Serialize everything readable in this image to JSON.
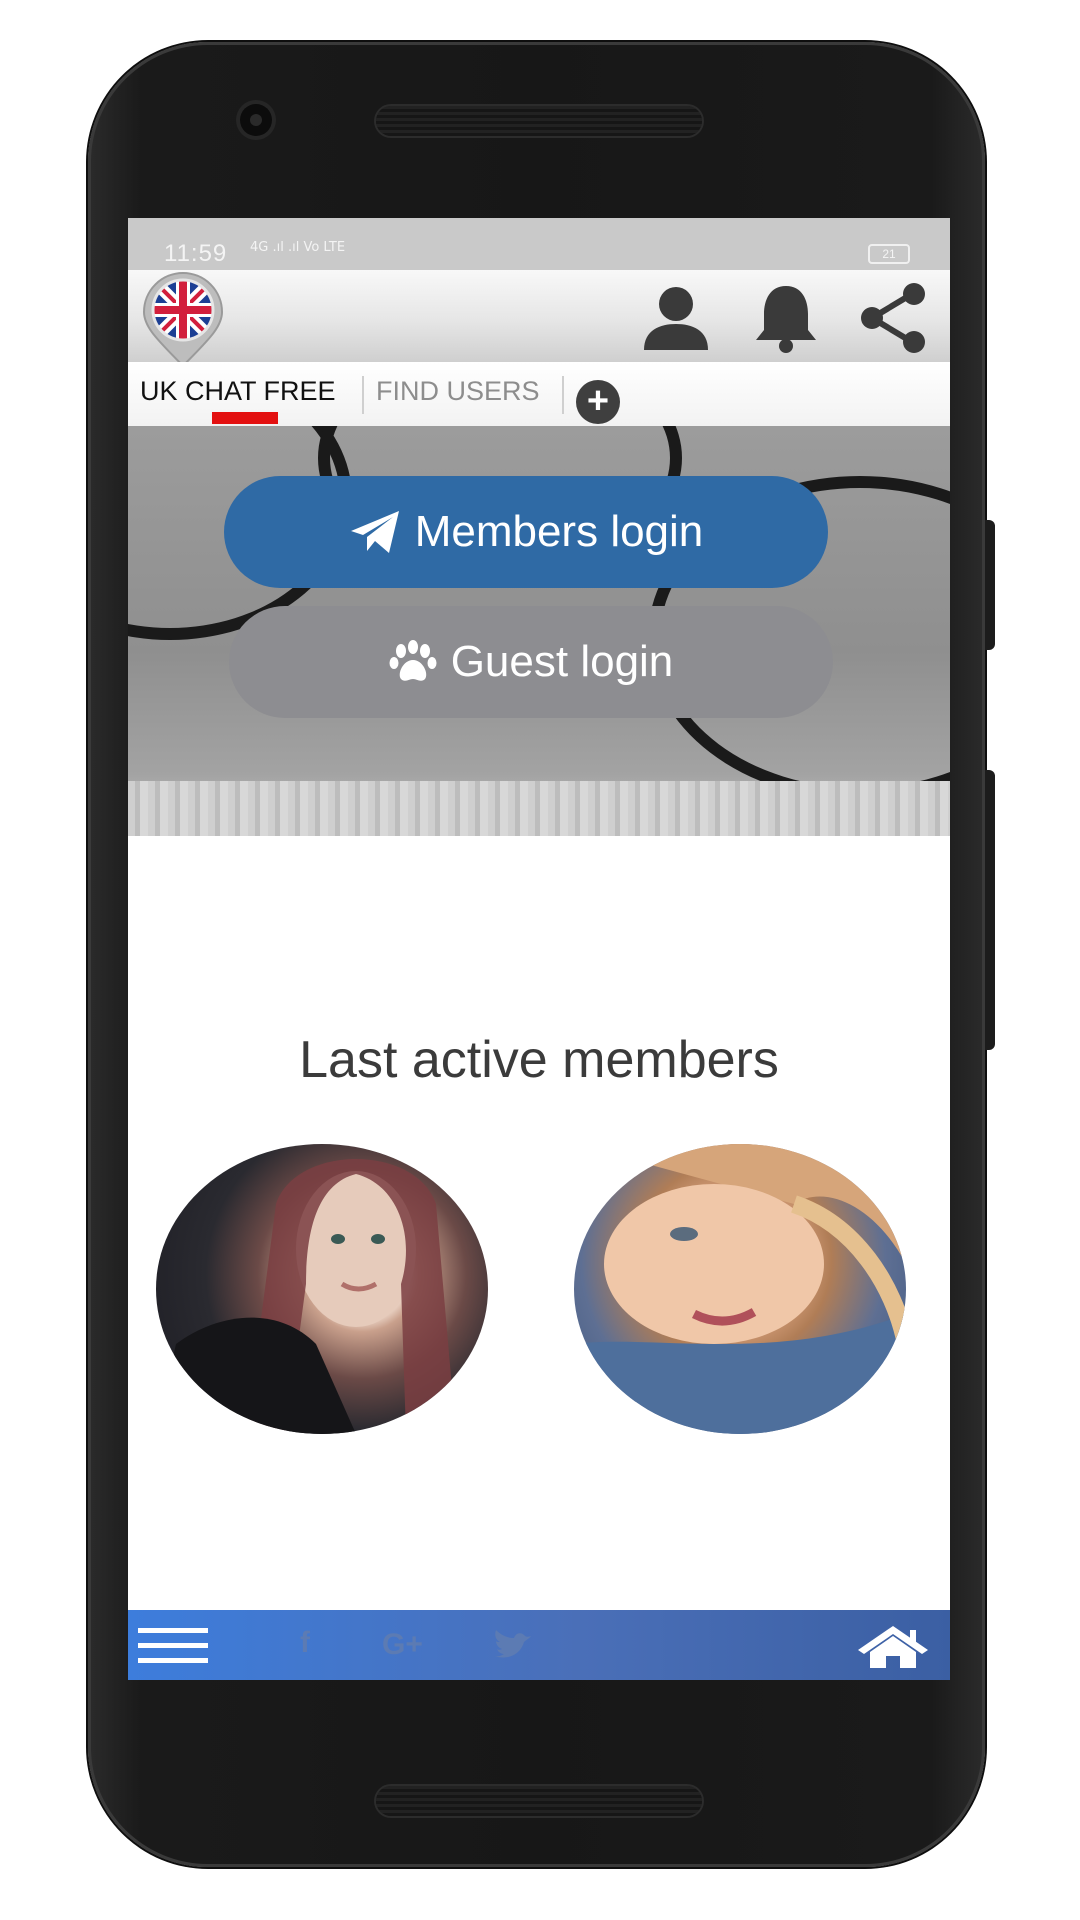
{
  "status_bar": {
    "time": "11:59",
    "signal": "4G .ıl .ıl Vo LTE",
    "battery": "21"
  },
  "top_bar": {
    "logo_icon": "uk-flag-pin-icon",
    "icons": [
      "user-icon",
      "bell-icon",
      "share-icon"
    ]
  },
  "tabs": {
    "items": [
      {
        "label": "UK CHAT FREE",
        "active": true
      },
      {
        "label": "FIND USERS",
        "active": false
      }
    ],
    "add_icon": "plus-icon",
    "accent_color": "#d21f3c"
  },
  "hero": {
    "members_login": "Members login",
    "members_icon": "paper-plane-icon",
    "guest_login": "Guest login",
    "guest_icon": "paw-icon"
  },
  "members_section": {
    "title": "Last active members",
    "members": [
      {
        "avatar": "member-photo-1"
      },
      {
        "avatar": "member-photo-2"
      }
    ]
  },
  "bottom_bar": {
    "icons": [
      "menu-icon",
      "facebook-icon",
      "google-plus-icon",
      "twitter-icon",
      "home-icon"
    ],
    "gplus_text": "G+",
    "fb_text": "f"
  },
  "colors": {
    "primary_button": "#2f6aa5",
    "guest_button": "#8d8d91",
    "bottom_bar": "#3d7ddc",
    "tab_underline": "#e31010"
  }
}
